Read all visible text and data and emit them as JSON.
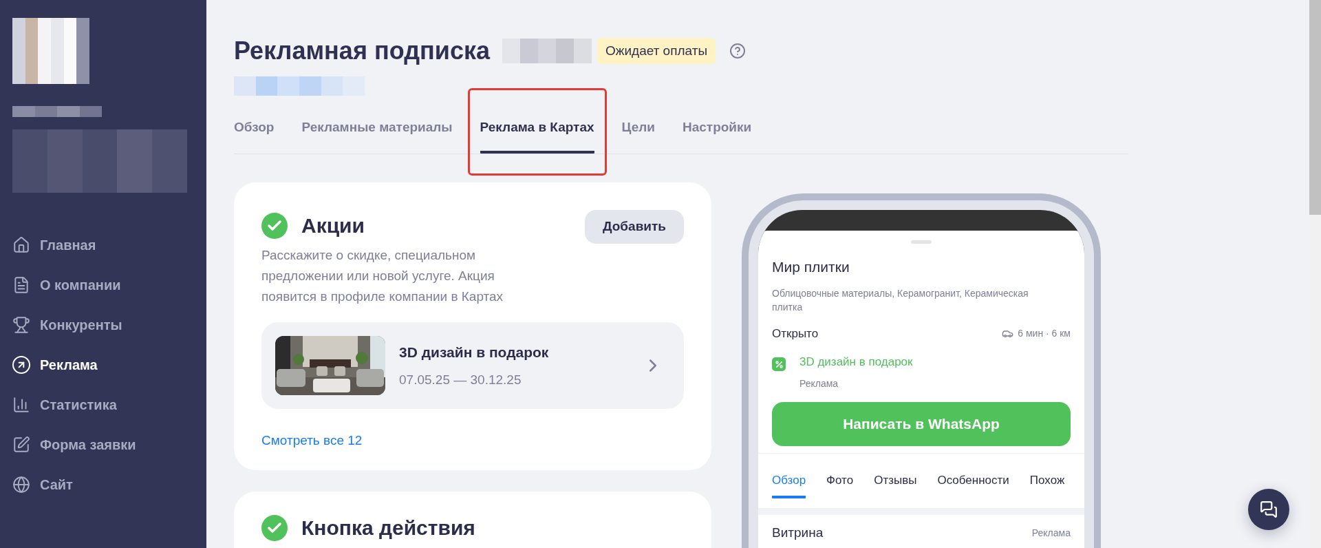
{
  "sidebar": {
    "items": [
      {
        "label": "Главная",
        "selected": false
      },
      {
        "label": "О компании",
        "selected": false
      },
      {
        "label": "Конкуренты",
        "selected": false
      },
      {
        "label": "Реклама",
        "selected": true
      },
      {
        "label": "Статистика",
        "selected": false
      },
      {
        "label": "Форма заявки",
        "selected": false
      },
      {
        "label": "Сайт",
        "selected": false
      }
    ]
  },
  "header": {
    "title": "Рекламная подписка",
    "status": "Ожидает оплаты"
  },
  "tabs": [
    {
      "label": "Обзор",
      "selected": false,
      "highlighted": false
    },
    {
      "label": "Рекламные материалы",
      "selected": false,
      "highlighted": false
    },
    {
      "label": "Реклама в Картах",
      "selected": true,
      "highlighted": true
    },
    {
      "label": "Цели",
      "selected": false,
      "highlighted": false
    },
    {
      "label": "Настройки",
      "selected": false,
      "highlighted": false
    }
  ],
  "promo_card": {
    "checked": true,
    "title": "Акции",
    "add_button": "Добавить",
    "description": "Расскажите о скидке, специальном предложении или новой услуге. Акция появится в профиле компании в Картах",
    "item": {
      "title": "3D дизайн в подарок",
      "dates": "07.05.25 — 30.12.25"
    },
    "see_all": "Смотреть все 12"
  },
  "action_card": {
    "checked": true,
    "title": "Кнопка действия"
  },
  "phone": {
    "name": "Мир плитки",
    "categories": "Облицовочные материалы, Керамогранит, Керамическая плитка",
    "status": "Открыто",
    "route": "6 мин · 6 км",
    "promo": "3D дизайн в подарок",
    "promo_label": "Реклама",
    "cta": "Написать в WhatsApp",
    "tabs": [
      {
        "label": "Обзор",
        "selected": true
      },
      {
        "label": "Фото",
        "selected": false
      },
      {
        "label": "Отзывы",
        "selected": false
      },
      {
        "label": "Особенности",
        "selected": false
      },
      {
        "label": "Похож",
        "selected": false
      }
    ],
    "section": "Витрина",
    "section_label": "Реклама"
  }
}
